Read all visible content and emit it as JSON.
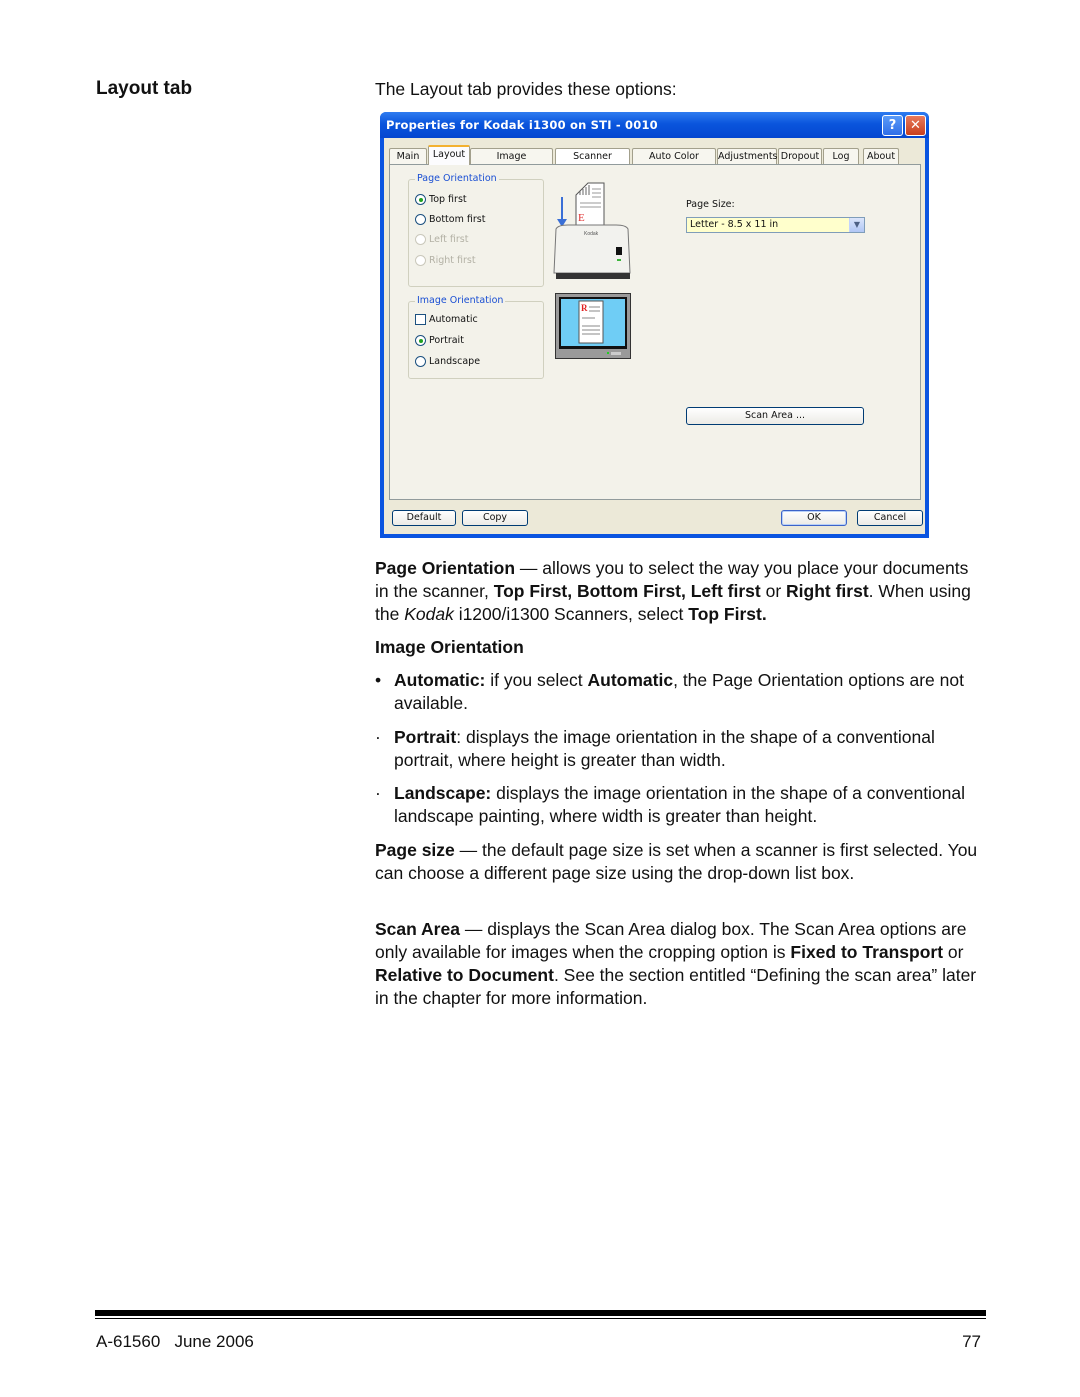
{
  "section_title": "Layout tab",
  "intro": "The Layout tab provides these options:",
  "dialog": {
    "title": "Properties for Kodak i1300 on STI - 0010",
    "help_icon": "?",
    "close_icon": "✕",
    "tabs": [
      {
        "label": "Main",
        "active": false
      },
      {
        "label": "Layout",
        "active": true
      },
      {
        "label": "Image Processing",
        "active": false
      },
      {
        "label": "Scanner",
        "active": false
      },
      {
        "label": "Auto Color Detect",
        "active": false
      },
      {
        "label": "Adjustments",
        "active": false
      },
      {
        "label": "Dropout",
        "active": false
      },
      {
        "label": "Log",
        "active": false
      },
      {
        "label": "About",
        "active": false
      }
    ],
    "page_orientation": {
      "label": "Page Orientation",
      "options": [
        {
          "label": "Top first",
          "checked": true,
          "enabled": true
        },
        {
          "label": "Bottom first",
          "checked": false,
          "enabled": true
        },
        {
          "label": "Left first",
          "checked": false,
          "enabled": false
        },
        {
          "label": "Right first",
          "checked": false,
          "enabled": false
        }
      ]
    },
    "image_orientation": {
      "label": "Image Orientation",
      "automatic": {
        "label": "Automatic",
        "checked": false
      },
      "options": [
        {
          "label": "Portrait",
          "checked": true
        },
        {
          "label": "Landscape",
          "checked": false
        }
      ]
    },
    "scanner_brand": "Kodak",
    "page_size": {
      "label": "Page Size:",
      "value": "Letter - 8.5 x 11 in"
    },
    "scan_area_button": "Scan Area ...",
    "buttons": {
      "default": "Default",
      "copy": "Copy",
      "ok": "OK",
      "cancel": "Cancel"
    }
  },
  "body": {
    "page_orientation": {
      "term": "Page Orientation",
      "t1": " — allows you to select the way you place your documents in the scanner, ",
      "b1": "Top First, Bottom First, Left first",
      "t2": " or ",
      "b2": "Right first",
      "t3": ". When using the ",
      "i1": "Kodak",
      "t4": " i1200/i1300 Scanners, select ",
      "b3": "Top First."
    },
    "image_orientation_heading": "Image Orientation",
    "bullets": {
      "automatic": {
        "term": "Automatic:",
        "t1": " if you select ",
        "b1": "Automatic",
        "t2": ", the Page Orientation options are not available."
      },
      "portrait": {
        "term": "Portrait",
        "t1": ": displays the image orientation in the shape of a conventional portrait, where height is greater than width."
      },
      "landscape": {
        "term": "Landscape:",
        "t1": " displays the image orientation in the shape of a conventional landscape painting, where width is greater than height."
      }
    },
    "page_size": {
      "term": "Page size",
      "t1": " — the default page size is set when a scanner is first selected. You can choose a different page size using the drop-down list box."
    },
    "scan_area": {
      "term": "Scan Area",
      "t1": " — displays the Scan Area dialog box. The Scan Area options are only available for images when the cropping option is ",
      "b1": "Fixed to Transport",
      "t2": " or ",
      "b2": "Relative to Document",
      "t3": ". See the section entitled “Defining the scan area” later in the chapter for more information."
    }
  },
  "footer": {
    "doc_id_date": "A-61560   June 2006",
    "page_number": "77"
  }
}
